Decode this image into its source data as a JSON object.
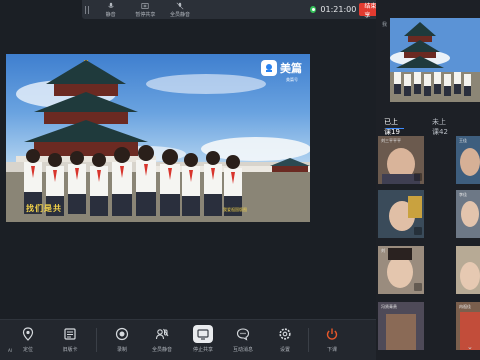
{
  "topbar": {
    "buttons": [
      {
        "label": "静音",
        "icon": "mic-icon"
      },
      {
        "label": "暂停共享",
        "icon": "pause-icon"
      },
      {
        "label": "全员静音",
        "icon": "mute-all-icon"
      }
    ],
    "timer": "01:21:00",
    "end_share_label": "结束共享"
  },
  "video": {
    "logo_text": "美篇",
    "logo_sub": "美篇号",
    "caption_left": "找们是共",
    "caption_right": "我爱祖国版图"
  },
  "right_panel": {
    "teacher_label": "我",
    "tabs": [
      {
        "label": "已上课19"
      },
      {
        "label": "未上课42"
      }
    ],
    "tiles": [
      {
        "name": "刘三平平平"
      },
      {
        "name": "王佳"
      },
      {
        "name": ""
      },
      {
        "name": "李佳"
      },
      {
        "name": "刘"
      },
      {
        "name": ""
      },
      {
        "name": "冯贤青贵"
      },
      {
        "name": "冉祖佳"
      }
    ]
  },
  "toolbar": {
    "buttons": [
      {
        "label": "定位",
        "icon": "location-icon"
      },
      {
        "label": "旧版卡",
        "icon": "card-icon"
      },
      {
        "label": "录制",
        "icon": "record-icon"
      },
      {
        "label": "全员静音",
        "icon": "mute-all-icon"
      },
      {
        "label": "停止共享",
        "icon": "stop-share-icon"
      },
      {
        "label": "互动消息",
        "icon": "chat-icon"
      },
      {
        "label": "设置",
        "icon": "gear-icon"
      },
      {
        "label": "下课",
        "icon": "power-icon"
      }
    ],
    "bottom_left": "AI"
  },
  "colors": {
    "accent_red": "#e23b30",
    "accent_blue": "#3d8bff",
    "rec_green": "#35c25a",
    "power_orange": "#e8582a"
  }
}
